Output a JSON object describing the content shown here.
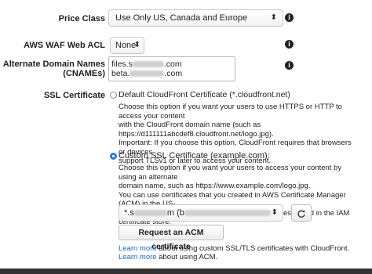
{
  "price_class": {
    "label": "Price Class",
    "value": "Use Only US, Canada and Europe"
  },
  "waf": {
    "label": "AWS WAF Web ACL",
    "value": "None"
  },
  "alt_domains": {
    "label_line1": "Alternate Domain Names",
    "label_line2": "(CNAMEs)",
    "line1_prefix": "files.s",
    "line1_suffix": ".com",
    "line2_prefix": "beta.",
    "line2_suffix": ".com"
  },
  "ssl": {
    "label": "SSL Certificate",
    "default_option": "Default CloudFront Certificate (*.cloudfront.net)",
    "default_desc": [
      "Choose this option if you want your users to use HTTPS or HTTP to access your content",
      "with the CloudFront domain name (such as",
      "https://d111111abcdef8.cloudfront.net/logo.jpg).",
      "Important: If you choose this option, CloudFront requires that browsers or devices",
      "support TLSv1 or later to access your content."
    ],
    "custom_option": "Custom SSL Certificate (example.com):",
    "custom_desc": [
      "Choose this option if you want your users to access your content by using an alternate",
      "domain name, such as https://www.example.com/logo.jpg.",
      "You can use certificates that you created in AWS Certificate Manager (ACM) in the US-",
      "East (N. Virginia) Region, or you can use certificates stored in the IAM certificate store."
    ],
    "cert_prefix": "*.s",
    "cert_mid": "m (b",
    "request_button": "Request an ACM certificate",
    "learn_link": "Learn more",
    "learn1_text": " about using custom SSL/TLS certificates with CloudFront.",
    "learn2_text": " about using ACM."
  },
  "icons": {
    "info": "info-icon",
    "refresh": "refresh-icon",
    "chevron": "chevron-down-icon"
  }
}
